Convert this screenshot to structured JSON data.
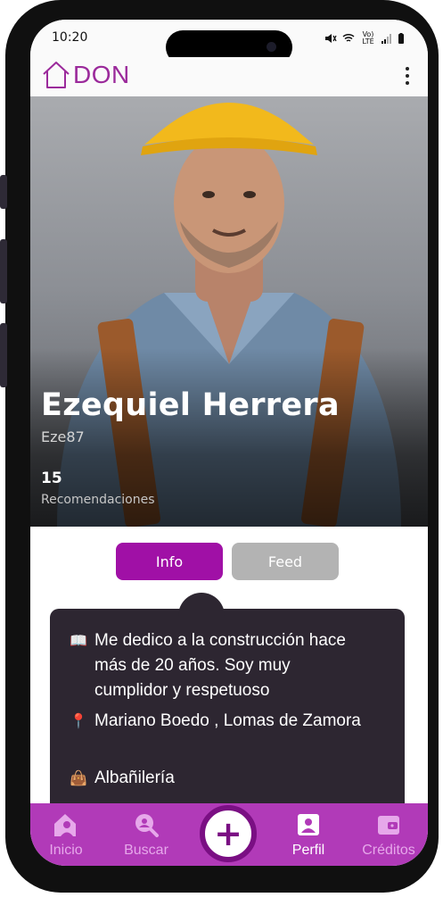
{
  "status_bar": {
    "time": "10:20",
    "network_label": "Vo) LTE"
  },
  "app": {
    "logo_text": "DON",
    "brand_color": "#9b2a9b",
    "accent_color": "#a010a6"
  },
  "profile": {
    "name": "Ezequiel Herrera",
    "username": "Eze87",
    "recommendations_count": "15",
    "recommendations_label": "Recomendaciones"
  },
  "tabs": [
    {
      "label": "Info",
      "active": true
    },
    {
      "label": "Feed",
      "active": false
    }
  ],
  "info": {
    "bio_icon": "book-icon",
    "bio": "Me dedico a la construcción hace más de 20 años. Soy muy cumplidor y respetuoso",
    "location_icon": "pin-icon",
    "location": "Mariano Boedo , Lomas de Zamora",
    "trade_icon": "bag-icon",
    "trade": "Albañilería"
  },
  "bottom_nav": {
    "items": [
      {
        "label": "Inicio",
        "icon": "home-user-icon",
        "active": false
      },
      {
        "label": "Buscar",
        "icon": "search-user-icon",
        "active": false
      },
      {
        "label": "Perfil",
        "icon": "profile-icon",
        "active": true
      },
      {
        "label": "Créditos",
        "icon": "wallet-icon",
        "active": false
      }
    ],
    "fab_icon": "plus-icon"
  }
}
